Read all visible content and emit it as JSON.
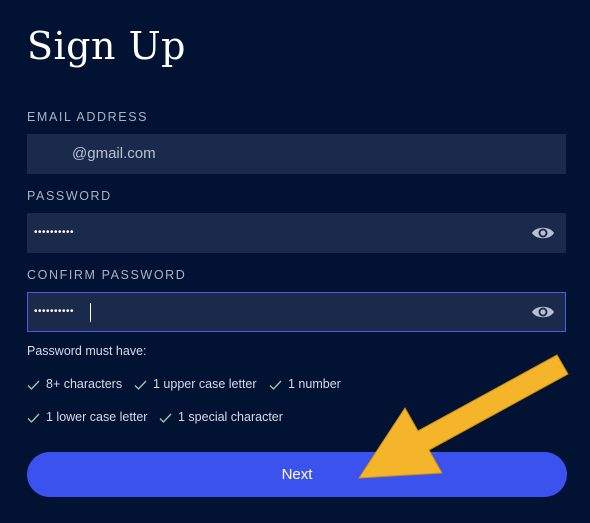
{
  "title": "Sign Up",
  "email": {
    "label": "EMAIL ADDRESS",
    "value": "@gmail.com"
  },
  "password": {
    "label": "PASSWORD",
    "masked_value": "••••••••••",
    "toggle_icon": "eye-icon"
  },
  "confirm_password": {
    "label": "CONFIRM PASSWORD",
    "masked_value": "••••••••••",
    "toggle_icon": "eye-icon"
  },
  "requirements": {
    "heading": "Password must have:",
    "items": [
      "8+ characters",
      "1 upper case letter",
      "1 number",
      "1 lower case letter",
      "1 special character"
    ],
    "check_icon": "check-icon"
  },
  "next_button": {
    "label": "Next"
  },
  "colors": {
    "background": "#021233",
    "field": "#1a2a4a",
    "accent": "#3c52ee",
    "focus_border": "#4b5bea",
    "annotation_arrow": "#f5b52a"
  }
}
